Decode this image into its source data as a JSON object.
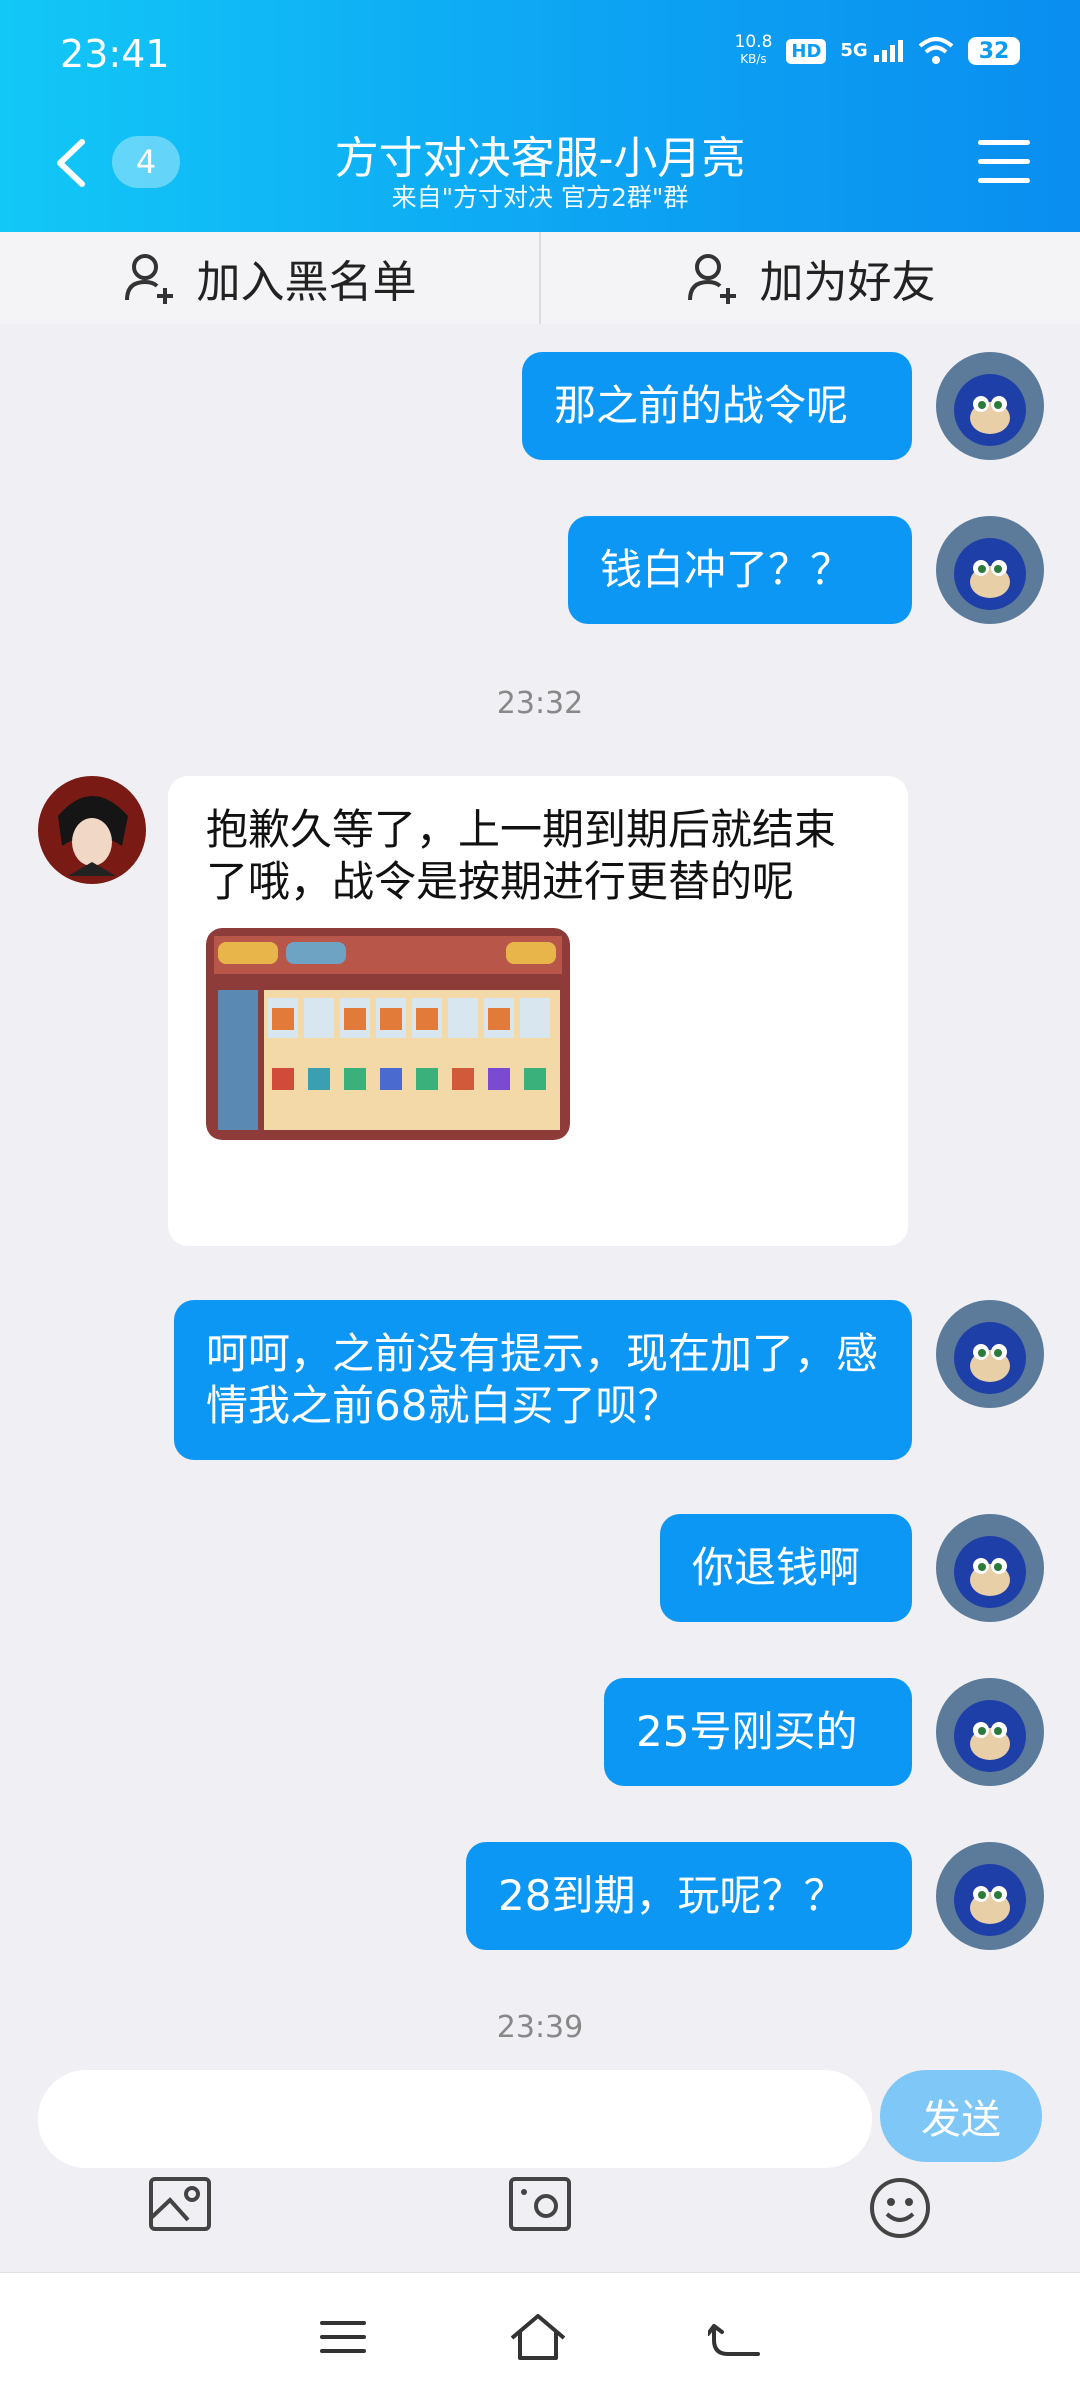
{
  "status_bar": {
    "time": "23:41",
    "speed_value": "10.8",
    "speed_unit": "KB/s",
    "hd": "HD",
    "network": "5G",
    "battery": "32"
  },
  "header": {
    "unread_count": "4",
    "title": "方寸对决客服-小月亮",
    "subtitle": "来自\"方寸对决 官方2群\"群"
  },
  "actions": {
    "blacklist": "加入黑名单",
    "add_friend": "加为好友"
  },
  "messages": {
    "m1": "那之前的战令呢",
    "m2": "钱白冲了？？",
    "t1": "23:32",
    "m3": "抱歉久等了，上一期到期后就结束了哦，战令是按期进行更替的呢",
    "m4": "呵呵，之前没有提示，现在加了，感情我之前68就白买了呗？",
    "m5": "你退钱啊",
    "m6": "25号刚买的",
    "m7": "28到期，玩呢？？",
    "t2": "23:39"
  },
  "composer": {
    "placeholder": "",
    "send_label": "发送"
  },
  "colors": {
    "header_start": "#12c8f7",
    "header_end": "#0a8ef0",
    "outgoing_bubble": "#0d97f5",
    "send_button": "#7ec7f6"
  }
}
